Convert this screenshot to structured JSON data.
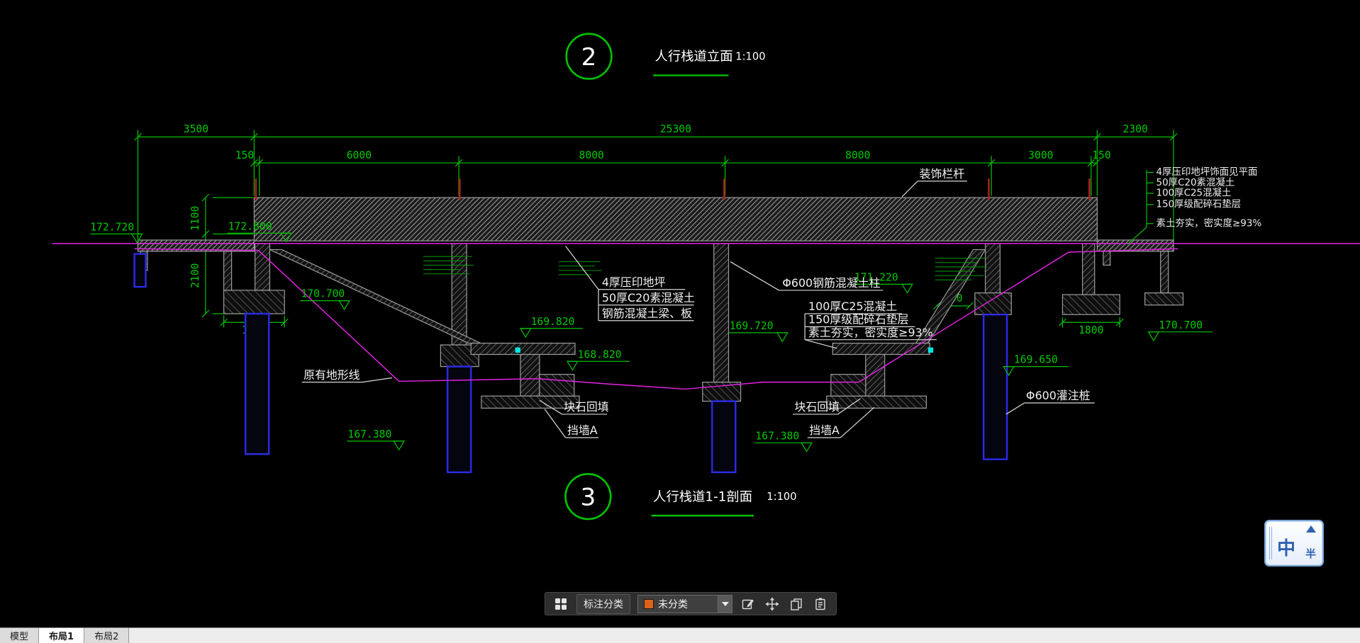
{
  "colors": {
    "cad_green": "#00c000",
    "terrain_magenta": "#e423e4",
    "pile_blue": "#2a2ae6",
    "mark_red": "#b22222",
    "swatch_orange": "#e0621a"
  },
  "views": {
    "elevation": {
      "number": "2",
      "title": "人行栈道立面",
      "scale": "1:100"
    },
    "section": {
      "number": "3",
      "title": "人行栈道1-1剖面",
      "scale": "1:100"
    }
  },
  "dims": {
    "top": {
      "d1": "3500",
      "d2": "25300",
      "d3": "2300"
    },
    "sub": {
      "d1": "150",
      "d2": "6000",
      "d3": "8000",
      "d4": "8000",
      "d5": "3000",
      "d6": "150"
    },
    "vert": {
      "d1": "1100",
      "d2": "2100"
    },
    "footing_left": "1800",
    "footing_right": "1800",
    "col_width": "600"
  },
  "elev": {
    "e1": "172.720",
    "e2": "172.800",
    "e3": "170.700",
    "e4": "169.820",
    "e5": "168.820",
    "e6": "169.720",
    "e7": "171.220",
    "e8": "167.380",
    "e9": "167.380",
    "e10": "169.650",
    "e11": "170.700"
  },
  "labels": {
    "railing": "装饰栏杆",
    "deck_note1": "4厚压印地坪",
    "deck_note2": "50厚C20素混凝土",
    "deck_note3": "钢筋混凝土梁、板",
    "column": "Φ600钢筋混凝土柱",
    "base_note1": "100厚C25混凝土",
    "base_note2": "150厚级配碎石垫层",
    "base_note3": "素土夯实，密实度≥93%",
    "terrain": "原有地形线",
    "rock_left": "块石回填",
    "rock_right": "块石回填",
    "wall_left": "挡墙A",
    "wall_right": "挡墙A",
    "pile": "Φ600灌注桩"
  },
  "notes_right": {
    "n1": "4厚压印地坪饰面见平面",
    "n2": "50厚C20素混凝土",
    "n3": "100厚C25混凝土",
    "n4": "150厚级配碎石垫层",
    "n5": "素土夯实，密实度≥93%"
  },
  "toolbar": {
    "annotate_label": "标注分类",
    "dropdown_value": "未分类"
  },
  "tabs": {
    "model": "模型",
    "layout1": "布局1",
    "layout2": "布局2"
  },
  "ime": {
    "cn": "中",
    "half": "半"
  }
}
